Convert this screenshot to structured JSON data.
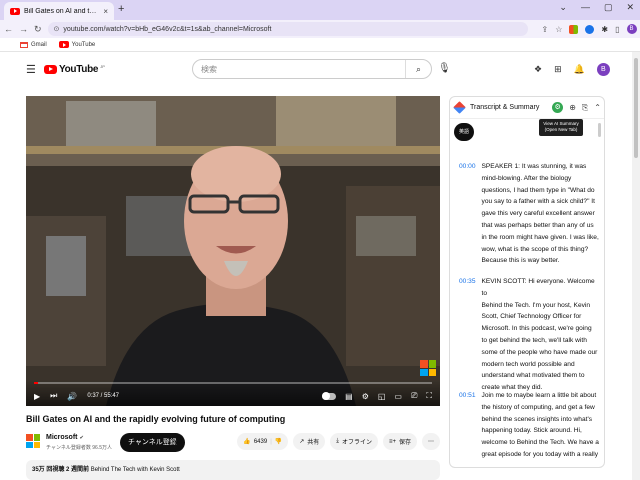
{
  "browser": {
    "tab_title": "Bill Gates on AI and the rapidly evolvi",
    "tab_close": "×",
    "new_tab": "+",
    "url": "youtube.com/watch?v=bHb_eG46v2c&t=1s&ab_channel=Microsoft",
    "bookmarks": [
      {
        "label": "Gmail",
        "icon": "gmail-icon"
      },
      {
        "label": "YouTube",
        "icon": "youtube-icon"
      }
    ]
  },
  "youtube": {
    "logo_text": "YouTube",
    "logo_region": "JP",
    "search_placeholder": "検索"
  },
  "video": {
    "time": "0:37 / 55:47",
    "progress_fraction": 0.011
  },
  "video_info": {
    "title": "Bill Gates on AI and the rapidly evolving future of computing",
    "channel": "Microsoft",
    "verified": "✔",
    "subscribers": "チャンネル登録者数 96.5万人",
    "subscribe_label": "チャンネル登録",
    "likes": "6439",
    "share": "共有",
    "offline": "オフライン",
    "save": "保存",
    "views_date": "35万 回視聴  2 週間前",
    "desc_snippet": "Behind The Tech with Kevin Scott"
  },
  "panel": {
    "title": "Transcript & Summary",
    "tooltip": "View AI Summary (Open New Tab)",
    "lang_button": "英語",
    "segments": [
      {
        "ts": "00:00",
        "lines": [
          "SPEAKER 1: It was stunning, it was",
          "mind-blowing. After the biology",
          "questions, I had them type in \"What do",
          "you say to a father with a sick child?\" It",
          "gave this very careful excellent answer",
          "that was perhaps better than any of us",
          "in the room might have given. I was like,",
          "wow, what is the scope of this thing?",
          "Because this is way better."
        ]
      },
      {
        "ts": "00:35",
        "lines": [
          "KEVIN SCOTT: Hi everyone. Welcome to",
          "Behind the Tech. I'm your host, Kevin",
          "Scott, Chief Technology Officer for",
          "Microsoft. In this podcast, we're going",
          "to get behind the tech, we'll talk with",
          "some of the people who have made our",
          "modern tech world possible and",
          "understand what motivated them to",
          "create what they did."
        ]
      },
      {
        "ts": "00:51",
        "lines": [
          "Join me to maybe learn a little bit about",
          "the history of computing, and get a few",
          "behind the scenes insights into what's",
          "happening today. Stick around. Hi,",
          "welcome to Behind the Tech. We have a",
          "great episode for you today with a really"
        ]
      }
    ]
  },
  "colors": {
    "accent": "#ff0000",
    "timestamp": "#1a73e8",
    "browser_frame": "#dbd4f4"
  }
}
